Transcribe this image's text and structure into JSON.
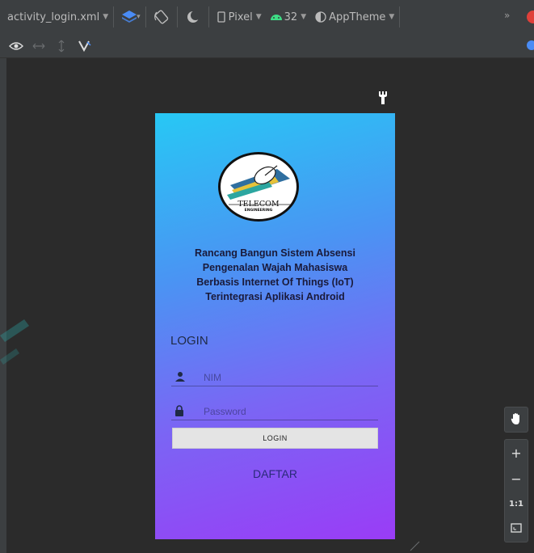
{
  "toolbar": {
    "file_name": "activity_login.xml",
    "device": "Pixel",
    "api_level": "32",
    "theme": "AppTheme",
    "overflow": "»"
  },
  "icons": {
    "design_surface": "layers-icon",
    "orientation": "rotate-icon",
    "night_mode": "night-mode-icon",
    "device": "phone-icon",
    "api": "android-icon",
    "theme": "theme-icon",
    "notification": "error-badge-icon",
    "visibility": "eye-icon",
    "hand": "pan-hand-icon"
  },
  "colors": {
    "ide_bg": "#2b2b2b",
    "toolbar_bg": "#3c3f41",
    "accent_blue": "#4a8cf5",
    "error_red": "#e0403a",
    "gradient_top": "#27c8f4",
    "gradient_bottom": "#9a3cf6"
  },
  "phone": {
    "logo": {
      "main_text": "TELECOM",
      "sub_text": "ENGINEERING"
    },
    "title_lines": [
      "Rancang Bangun Sistem Absensi",
      "Pengenalan Wajah Mahasiswa",
      "Berbasis Internet Of Things (IoT)",
      "Terintegrasi Aplikasi Android"
    ],
    "login_heading": "LOGIN",
    "nim_placeholder": "NIM",
    "password_placeholder": "Password",
    "login_button": "LOGIN",
    "register_link": "DAFTAR"
  },
  "zoom": {
    "zoom_in": "+",
    "zoom_out": "−",
    "actual_size": "1:1"
  }
}
